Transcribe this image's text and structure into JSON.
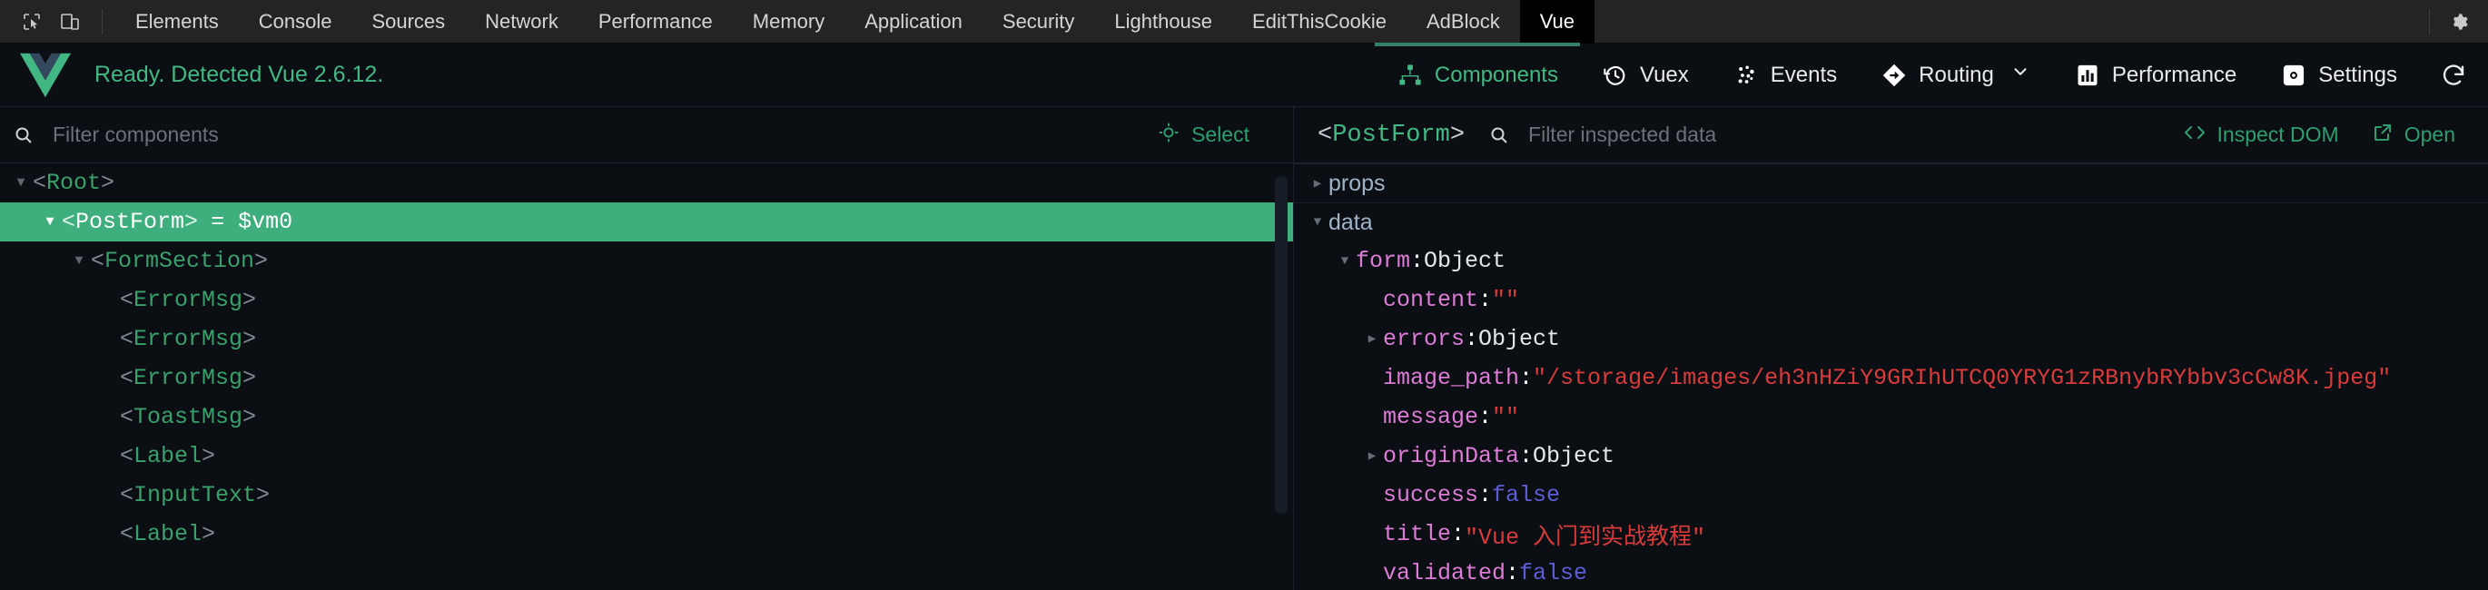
{
  "devtools": {
    "icons": [
      {
        "name": "inspect-element-icon"
      },
      {
        "name": "device-toolbar-icon"
      }
    ],
    "tabs": [
      {
        "label": "Elements",
        "active": false
      },
      {
        "label": "Console",
        "active": false
      },
      {
        "label": "Sources",
        "active": false
      },
      {
        "label": "Network",
        "active": false
      },
      {
        "label": "Performance",
        "active": false
      },
      {
        "label": "Memory",
        "active": false
      },
      {
        "label": "Application",
        "active": false
      },
      {
        "label": "Security",
        "active": false
      },
      {
        "label": "Lighthouse",
        "active": false
      },
      {
        "label": "EditThisCookie",
        "active": false
      },
      {
        "label": "AdBlock",
        "active": false
      },
      {
        "label": "Vue",
        "active": true
      }
    ],
    "settings_icon": "gear-icon"
  },
  "vue_panel": {
    "logo": "vue-logo",
    "status_text": "Ready. Detected Vue 2.6.12.",
    "tabs": [
      {
        "label": "Components",
        "icon": "components-tree-icon",
        "active": true,
        "chevron": false
      },
      {
        "label": "Vuex",
        "icon": "vuex-history-icon",
        "active": false,
        "chevron": false
      },
      {
        "label": "Events",
        "icon": "events-dots-icon",
        "active": false,
        "chevron": false
      },
      {
        "label": "Routing",
        "icon": "routing-arrow-icon",
        "active": false,
        "chevron": true
      },
      {
        "label": "Performance",
        "icon": "performance-bars-icon",
        "active": false,
        "chevron": false
      },
      {
        "label": "Settings",
        "icon": "settings-gear-icon",
        "active": false,
        "chevron": false
      }
    ],
    "refresh_icon": "refresh-icon",
    "toolbar": {
      "filter_placeholder": "Filter components",
      "filter_value": "",
      "search_icon": "search-icon",
      "select_label": "Select",
      "select_icon": "target-select-icon",
      "inspected_open": "<",
      "inspected_name": "PostForm",
      "inspected_close": ">",
      "data_filter_placeholder": "Filter inspected data",
      "data_filter_value": "",
      "inspect_dom_label": "Inspect DOM",
      "inspect_dom_icon": "code-brackets-icon",
      "open_label": "Open",
      "open_icon": "external-link-icon"
    },
    "tree": [
      {
        "arrow": "down",
        "indent": 0,
        "open": "<",
        "name": "Root",
        "close": ">",
        "suffix": "",
        "selected": false
      },
      {
        "arrow": "down",
        "indent": 1,
        "open": "<",
        "name": "PostForm",
        "close": ">",
        "suffix": "= $vm0",
        "selected": true
      },
      {
        "arrow": "down",
        "indent": 2,
        "open": "<",
        "name": "FormSection",
        "close": ">",
        "suffix": "",
        "selected": false
      },
      {
        "arrow": "none",
        "indent": 3,
        "open": "<",
        "name": "ErrorMsg",
        "close": ">",
        "suffix": "",
        "selected": false
      },
      {
        "arrow": "none",
        "indent": 3,
        "open": "<",
        "name": "ErrorMsg",
        "close": ">",
        "suffix": "",
        "selected": false
      },
      {
        "arrow": "none",
        "indent": 3,
        "open": "<",
        "name": "ErrorMsg",
        "close": ">",
        "suffix": "",
        "selected": false
      },
      {
        "arrow": "none",
        "indent": 3,
        "open": "<",
        "name": "ToastMsg",
        "close": ">",
        "suffix": "",
        "selected": false
      },
      {
        "arrow": "none",
        "indent": 3,
        "open": "<",
        "name": "Label",
        "close": ">",
        "suffix": "",
        "selected": false
      },
      {
        "arrow": "none",
        "indent": 3,
        "open": "<",
        "name": "InputText",
        "close": ">",
        "suffix": "",
        "selected": false
      },
      {
        "arrow": "none",
        "indent": 3,
        "open": "<",
        "name": "Label",
        "close": ">",
        "suffix": "",
        "selected": false
      }
    ],
    "inspector": [
      {
        "kind": "group",
        "arrow": "right",
        "label": "props"
      },
      {
        "kind": "group",
        "arrow": "down",
        "label": "data"
      },
      {
        "kind": "prop",
        "arrow": "down",
        "indent": 1,
        "key": "form",
        "value": "Object",
        "vtype": "obj"
      },
      {
        "kind": "prop",
        "arrow": "none",
        "indent": 2,
        "key": "content",
        "value": "\"\"",
        "vtype": "str"
      },
      {
        "kind": "prop",
        "arrow": "right",
        "indent": 2,
        "key": "errors",
        "value": "Object",
        "vtype": "obj"
      },
      {
        "kind": "prop",
        "arrow": "none",
        "indent": 2,
        "key": "image_path",
        "value": "\"/storage/images/eh3nHZiY9GRIhUTCQ0YRYG1zRBnybRYbbv3cCw8K.jpeg\"",
        "vtype": "str"
      },
      {
        "kind": "prop",
        "arrow": "none",
        "indent": 2,
        "key": "message",
        "value": "\"\"",
        "vtype": "str"
      },
      {
        "kind": "prop",
        "arrow": "right",
        "indent": 2,
        "key": "originData",
        "value": "Object",
        "vtype": "obj"
      },
      {
        "kind": "prop",
        "arrow": "none",
        "indent": 2,
        "key": "success",
        "value": "false",
        "vtype": "bool"
      },
      {
        "kind": "prop",
        "arrow": "none",
        "indent": 2,
        "key": "title",
        "value": "\"Vue 入门到实战教程\"",
        "vtype": "str"
      },
      {
        "kind": "prop",
        "arrow": "none",
        "indent": 2,
        "key": "validated",
        "value": "false",
        "vtype": "bool"
      }
    ]
  },
  "colors": {
    "vue_green": "#42b883",
    "selection_green": "#3eaf7c",
    "panel_bg": "#0b0f14",
    "devtools_bg": "#242424",
    "key_pink": "#dd7bd6",
    "string_red": "#d93b3b",
    "bool_blue": "#5d5dd8"
  }
}
